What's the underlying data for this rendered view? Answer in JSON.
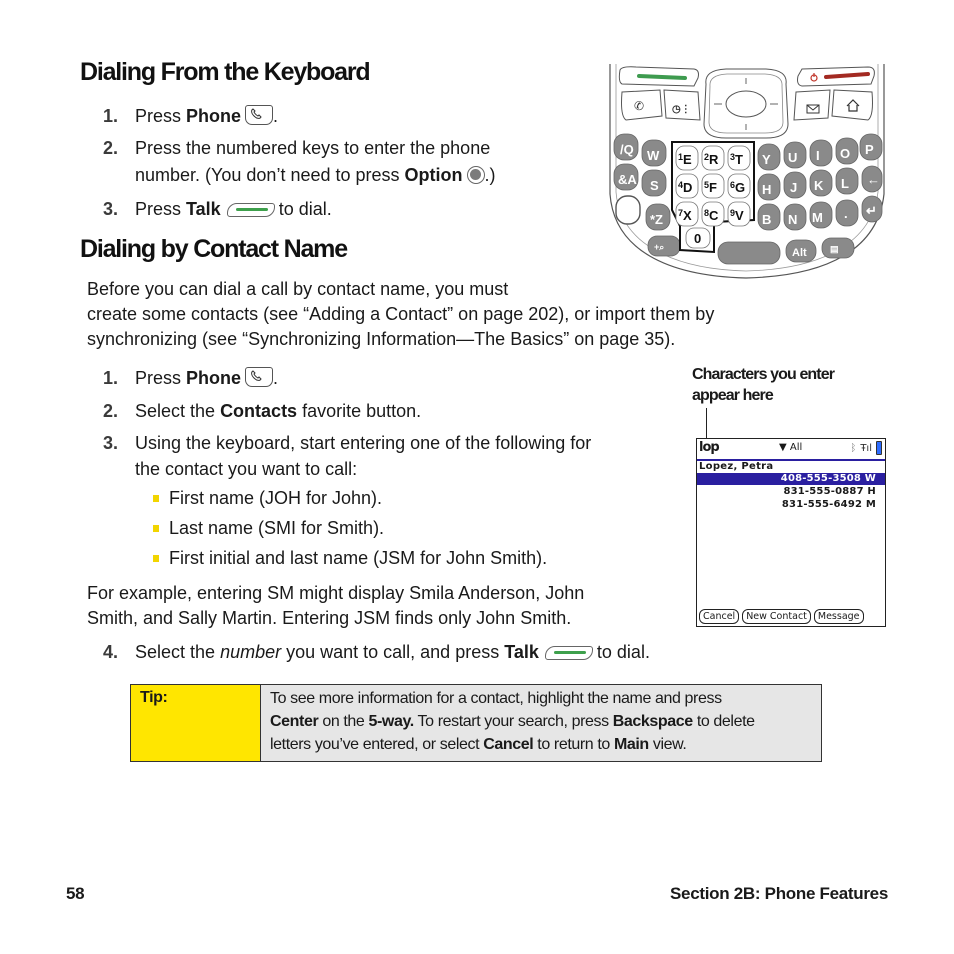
{
  "section1": {
    "heading": "Dialing From the Keyboard",
    "steps": [
      {
        "num": "1.",
        "pre": "Press ",
        "bold": "Phone",
        "icon": "phone-key-icon",
        "post": "."
      },
      {
        "num": "2.",
        "line1": "Press the numbered keys to enter the phone",
        "line2_pre": "number. (You don’t need to press ",
        "line2_bold": "Option",
        "icon": "option-key-icon",
        "line2_post": ".)"
      },
      {
        "num": "3.",
        "pre": "Press ",
        "bold": "Talk",
        "icon": "talk-key-icon",
        "post": "to dial."
      }
    ]
  },
  "section2": {
    "heading": "Dialing by Contact Name",
    "intro": [
      "Before you can dial a call by contact name, you must",
      "create some contacts (see “Adding a Contact” on page 202), or import them by",
      "synchronizing (see “Synchronizing Information—The Basics” on page 35)."
    ],
    "steps": [
      {
        "num": "1.",
        "pre": "Press ",
        "bold": "Phone",
        "icon": "phone-key-icon",
        "post": "."
      },
      {
        "num": "2.",
        "pre": "Select the ",
        "bold": "Contacts",
        "post": " favorite button."
      },
      {
        "num": "3.",
        "line1": "Using the keyboard, start entering one of the following for",
        "line2": "the contact you want to call:"
      }
    ],
    "bullets": [
      "First name (JOH for John).",
      "Last name (SMI for Smith).",
      "First initial and last name (JSM for John Smith)."
    ],
    "example": [
      "For example, entering SM might display Smila Anderson, John",
      "Smith, and Sally Martin. Entering JSM finds only John Smith."
    ],
    "step4": {
      "num": "4.",
      "pre": "Select the ",
      "italic": "number",
      "mid": " you want to call, and press ",
      "bold": "Talk",
      "icon": "talk-key-icon",
      "post": "to dial."
    }
  },
  "keyboard_figure": {
    "keys_row1": [
      "Q",
      "W",
      "E",
      "R",
      "T",
      "Y",
      "U",
      "I",
      "O",
      "P"
    ],
    "keys_row2": [
      "A",
      "S",
      "D",
      "F",
      "G",
      "H",
      "J",
      "K",
      "L"
    ],
    "keys_row3": [
      "Z",
      "X",
      "C",
      "V",
      "B",
      "N",
      "M",
      "."
    ],
    "number_keys": [
      {
        "n": "1",
        "l": "E"
      },
      {
        "n": "2",
        "l": "R"
      },
      {
        "n": "3",
        "l": "T"
      },
      {
        "n": "4",
        "l": "D"
      },
      {
        "n": "5",
        "l": "F"
      },
      {
        "n": "6",
        "l": "G"
      },
      {
        "n": "7",
        "l": "X"
      },
      {
        "n": "8",
        "l": "C"
      },
      {
        "n": "9",
        "l": "V"
      },
      {
        "n": "0",
        "l": ""
      }
    ],
    "alt_label": "Alt",
    "colors": {
      "talk": "#3e9b4f",
      "end": "#a32a22",
      "key": "#8a8a8a"
    }
  },
  "screen_figure": {
    "caption": [
      "Characters you enter",
      "appear here"
    ],
    "query": "lop",
    "category": "All",
    "contact": "Lopez, Petra",
    "numbers": [
      {
        "value": "408-555-3508 W",
        "selected": true
      },
      {
        "value": "831-555-0887 H",
        "selected": false
      },
      {
        "value": "831-555-6492 M",
        "selected": false
      }
    ],
    "buttons": [
      "Cancel",
      "New Contact",
      "Message"
    ],
    "highlight_color": "#2a1fa0"
  },
  "tip": {
    "label": "Tip:",
    "line1": "To see more information for a contact, highlight the name and press",
    "l2_b1": "Center",
    "l2_t1": " on the ",
    "l2_b2": "5-way.",
    "l2_t2": " To restart your search, press ",
    "l2_b3": "Backspace",
    "l2_t3": " to delete",
    "l3_t1": "letters you’ve entered, or select ",
    "l3_b1": "Cancel",
    "l3_t2": " to return to ",
    "l3_b2": "Main",
    "l3_t3": " view."
  },
  "footer": {
    "page": "58",
    "section": "Section 2B: Phone Features"
  }
}
